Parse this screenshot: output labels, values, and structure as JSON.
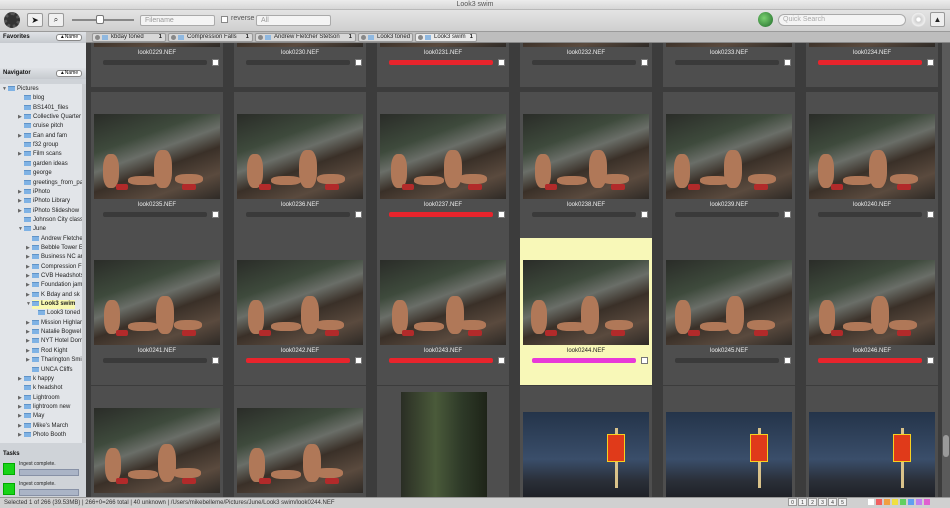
{
  "window": {
    "title": "Look3 swim"
  },
  "toolbar": {
    "filename_label": "Filename",
    "reverse_label": "reverse",
    "filter_value": "All",
    "search_placeholder": "Quick Search"
  },
  "sidebar": {
    "favorites": {
      "title": "Favorites",
      "sort_label": "▲Name"
    },
    "navigator": {
      "title": "Navigator",
      "sort_label": "▲Name"
    },
    "tree": [
      {
        "label": "Pictures"
      },
      {
        "label": "blog"
      },
      {
        "label": "BS1401_files"
      },
      {
        "label": "Collective Quarter"
      },
      {
        "label": "cruise pitch"
      },
      {
        "label": "Ean and fam"
      },
      {
        "label": "f32 group"
      },
      {
        "label": "Film scans"
      },
      {
        "label": "garden ideas"
      },
      {
        "label": "george"
      },
      {
        "label": "greetings_from_pa"
      },
      {
        "label": "iPhoto"
      },
      {
        "label": "iPhoto Library"
      },
      {
        "label": "iPhoto Slideshow"
      },
      {
        "label": "Johnson City class"
      },
      {
        "label": "June"
      },
      {
        "label": "Andrew Fletche"
      },
      {
        "label": "Bebble Tower E"
      },
      {
        "label": "Business NC ar"
      },
      {
        "label": "Compression F"
      },
      {
        "label": "CVB Headshots"
      },
      {
        "label": "Foundation jam"
      },
      {
        "label": "K Bday and sk"
      },
      {
        "label": "Look3 swim"
      },
      {
        "label": "Look3 toned"
      },
      {
        "label": "Mission Highlar"
      },
      {
        "label": "Natalie Bogwel"
      },
      {
        "label": "NYT Hotel Dorr"
      },
      {
        "label": "Rod Kight"
      },
      {
        "label": "Tharington Smi"
      },
      {
        "label": "UNCA Cliffs"
      },
      {
        "label": "k happy"
      },
      {
        "label": "k headshot"
      },
      {
        "label": "Lightroom"
      },
      {
        "label": "lightroom new"
      },
      {
        "label": "May"
      },
      {
        "label": "Mike's March"
      },
      {
        "label": "Photo Booth"
      }
    ],
    "tasks_title": "Tasks",
    "tasks": [
      {
        "label": "Ingest complete."
      },
      {
        "label": "Ingest complete."
      }
    ]
  },
  "tabs": [
    {
      "label": "kbday toned",
      "count": "1"
    },
    {
      "label": "Compression Falls",
      "count": "1"
    },
    {
      "label": "Andrew Fletcher Stetson",
      "count": "1"
    },
    {
      "label": "Look3 toned",
      "count": ""
    },
    {
      "label": "Look3 swim",
      "count": "1"
    }
  ],
  "rows": [
    {
      "names": [
        "look0229.NEF",
        "look0230.NEF",
        "look0231.NEF",
        "look0232.NEF",
        "look0233.NEF",
        "look0234.NEF"
      ]
    },
    {
      "names": [
        "look0235.NEF",
        "look0236.NEF",
        "look0237.NEF",
        "look0238.NEF",
        "look0239.NEF",
        "look0240.NEF"
      ]
    },
    {
      "names": [
        "look0241.NEF",
        "look0242.NEF",
        "look0243.NEF",
        "look0244.NEF",
        "look0245.NEF",
        "look0246.NEF"
      ]
    },
    {
      "names": [
        "",
        "",
        "",
        "",
        "",
        ""
      ]
    }
  ],
  "colors": {
    "red_label": "#e8242c",
    "magenta_label": "#e838d8",
    "selected": "#f8f8b8"
  },
  "status": {
    "text": "Selected 1 of 266 (39.53MB) | 266+0=266 total | 40 unknown | /Users/mikebelleme/Pictures/June/Look3 swim/look0244.NEF"
  },
  "stars": [
    "0",
    "1",
    "2",
    "3",
    "4",
    "5"
  ]
}
